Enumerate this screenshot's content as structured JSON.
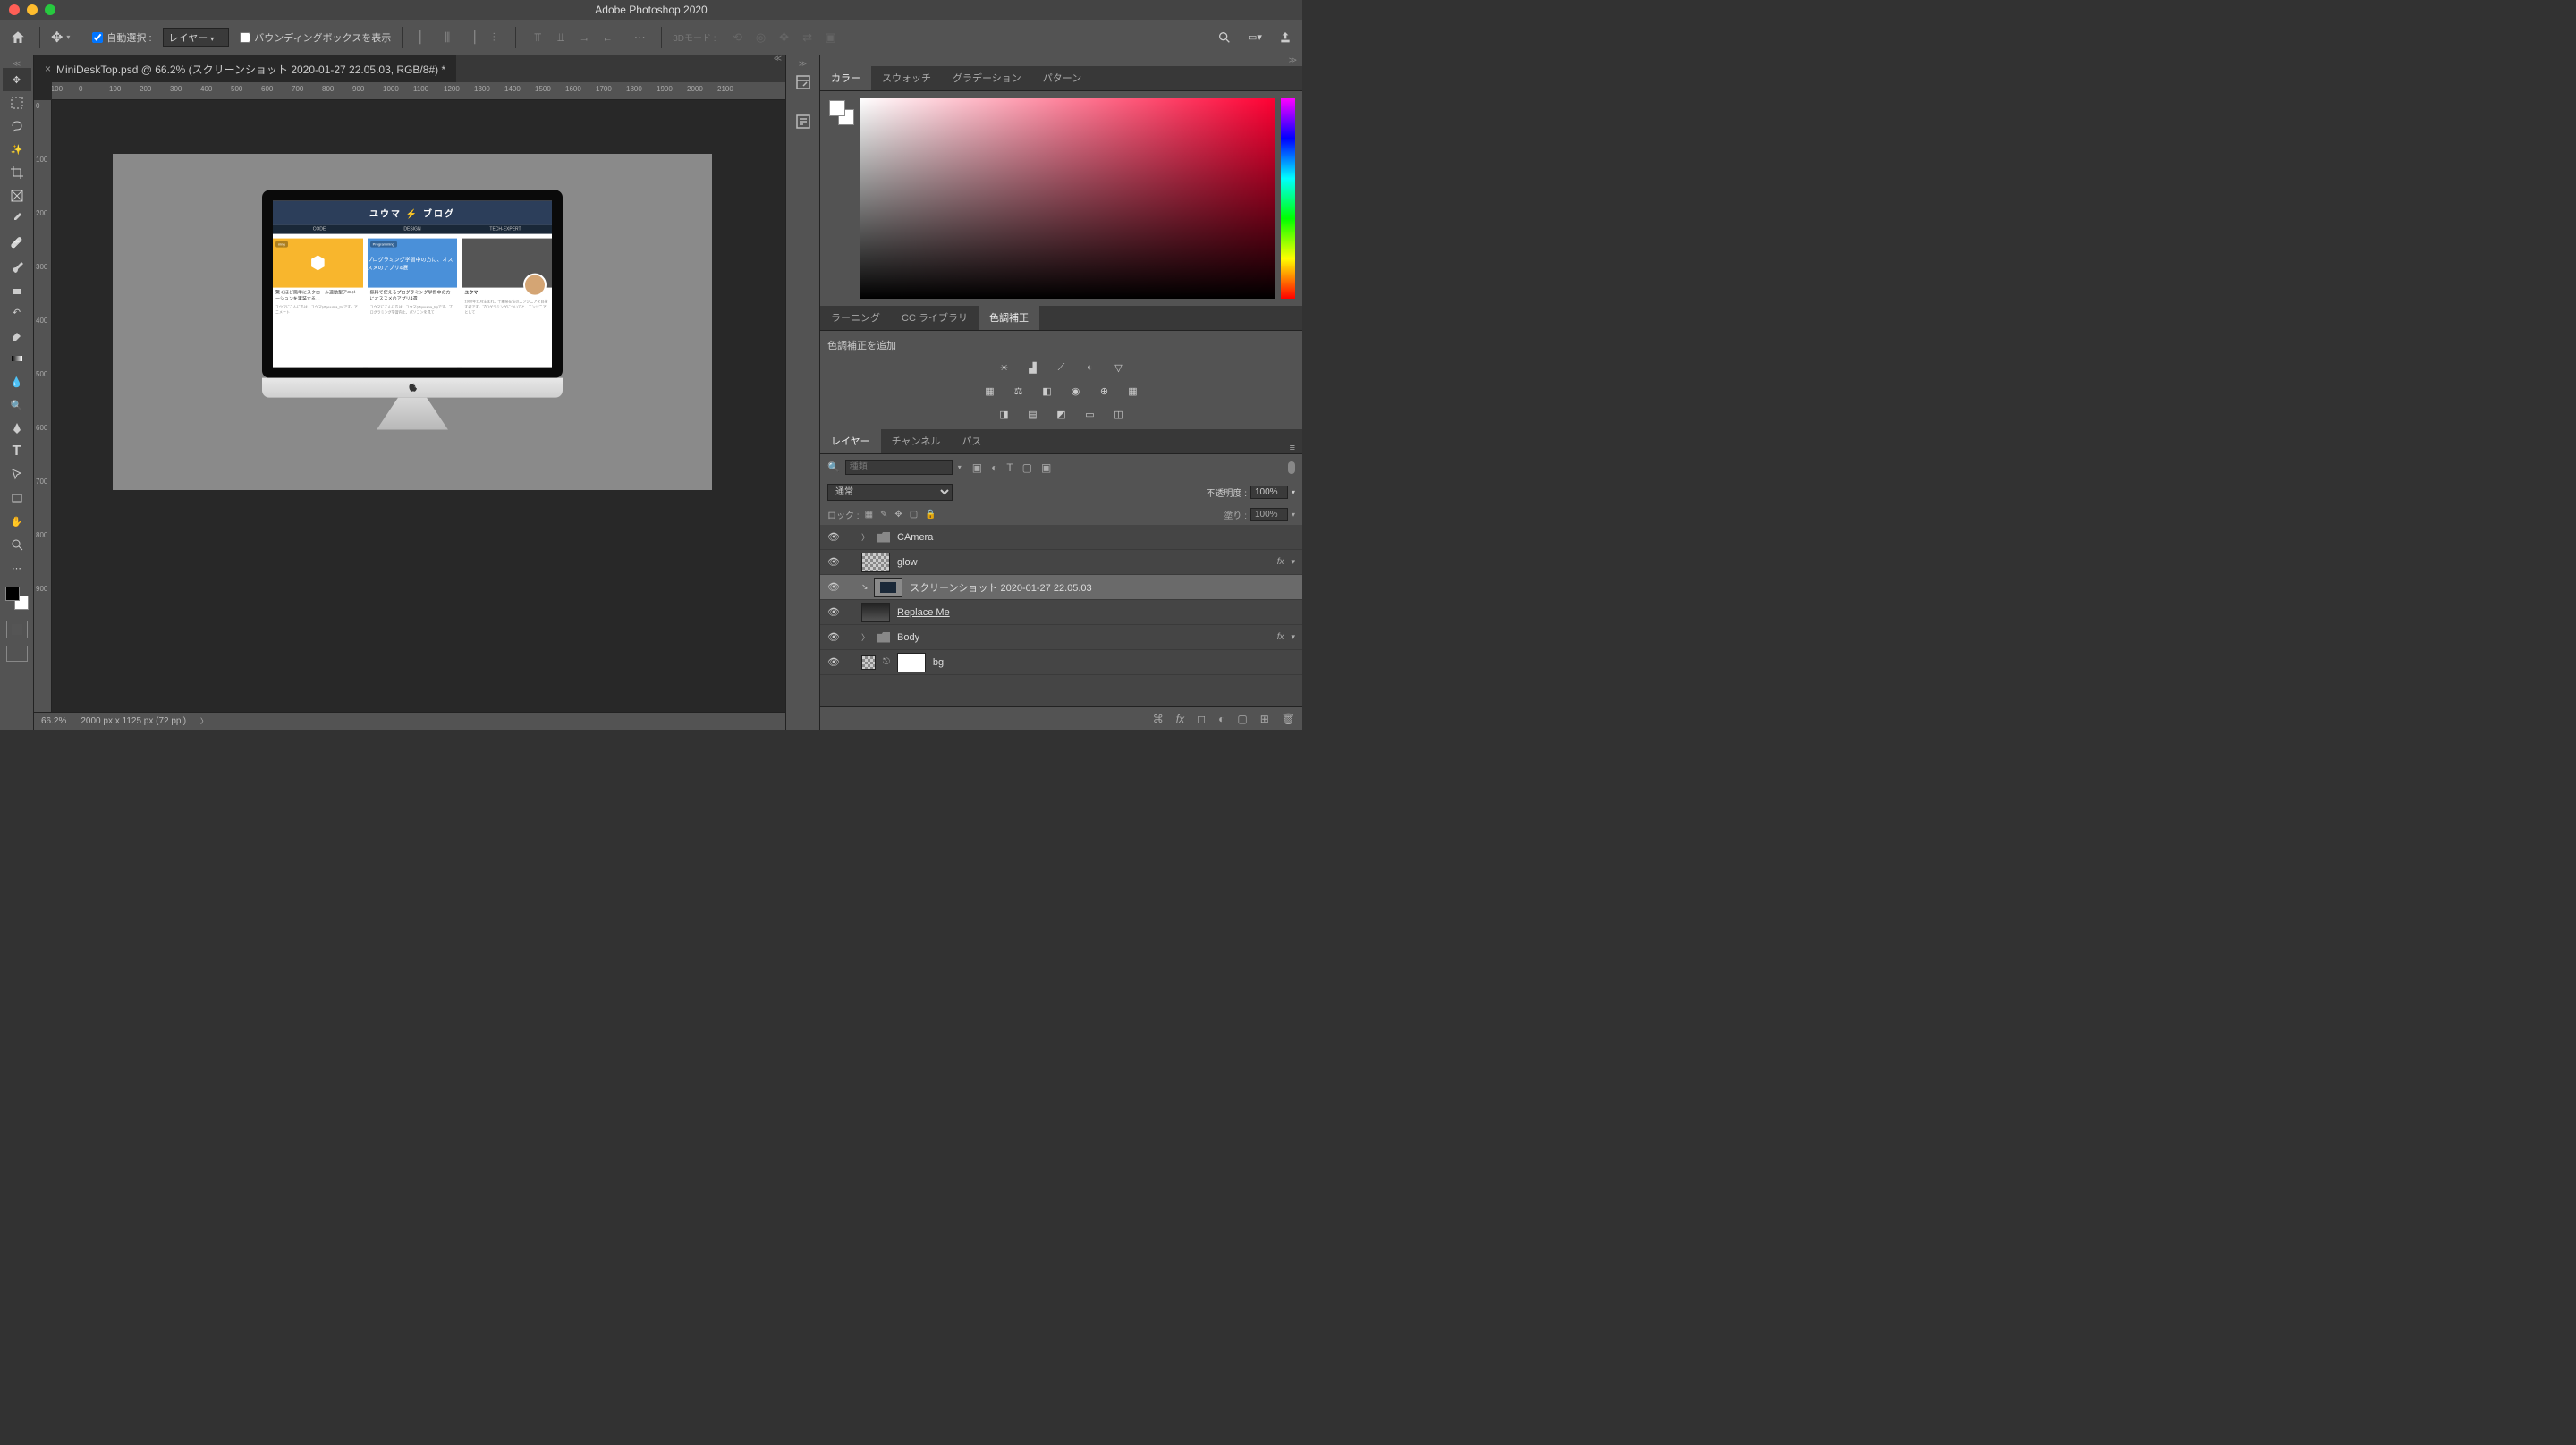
{
  "titlebar": {
    "app_title": "Adobe Photoshop 2020"
  },
  "options": {
    "auto_select_label": "自動選択 :",
    "layer_sel": "レイヤー",
    "bounding_box_label": "バウンディングボックスを表示",
    "mode3d_label": "3Dモード :"
  },
  "document": {
    "tab_title": "MiniDeskTop.psd @ 66.2% (スクリーンショット 2020-01-27 22.05.03, RGB/8#) *",
    "zoom": "66.2%",
    "dimensions": "2000 px x 1125 px (72 ppi)"
  },
  "ruler_marks_h": [
    "-100",
    "0",
    "100",
    "200",
    "300",
    "400",
    "500",
    "600",
    "700",
    "800",
    "900",
    "1000",
    "1100",
    "1200",
    "1300",
    "1400",
    "1500",
    "1600",
    "1700",
    "1800",
    "1900",
    "2000",
    "2100"
  ],
  "ruler_marks_v": [
    "0",
    "100",
    "200",
    "300",
    "400",
    "500",
    "600",
    "700",
    "800",
    "900"
  ],
  "mockup": {
    "blog_title": "ユウマ ⚡ ブログ",
    "nav": [
      "CODE",
      "DESIGN",
      "TECH-EXPERT"
    ],
    "cards": [
      {
        "badge": "ning",
        "title": "簡単にスクロール連動型",
        "txt": "驚くほど簡単にスクロール連動型アニメーションを実装する…",
        "sub": "ユウマにこんにちは、ユウマ(@yuuma_tn)です。アニメート"
      },
      {
        "badge": "Programming",
        "title": "プログラミング学習中の方に、オススメのアプリ4選",
        "txt": "無料で使えるプログラミング学習中の方にオススメのアプリ4選",
        "sub": "ユウマにこんにちは、ユウマ(@yuuma_tn)です。プログラミング学習向上、パソコンを見て"
      },
      {
        "badge": "",
        "title": "ユウマ",
        "txt": "1990年11月生まれ、千葉県在住のエンジニアを目指す者です。プログラミングについてと、エンジニアとして"
      }
    ]
  },
  "panels": {
    "color_tabs": [
      "カラー",
      "スウォッチ",
      "グラデーション",
      "パターン"
    ],
    "learn_tabs": [
      "ラーニング",
      "CC ライブラリ",
      "色調補正"
    ],
    "adjustments_label": "色調補正を追加",
    "layer_tabs": [
      "レイヤー",
      "チャンネル",
      "パス"
    ],
    "search_placeholder": "種類",
    "blend_mode": "通常",
    "opacity_label": "不透明度 :",
    "opacity_value": "100%",
    "lock_label": "ロック :",
    "fill_label": "塗り :",
    "fill_value": "100%",
    "layers": [
      {
        "name": "CAmera",
        "type": "folder"
      },
      {
        "name": "glow",
        "type": "layer",
        "fx": true
      },
      {
        "name": "スクリーンショット 2020-01-27 22.05.03",
        "type": "smart",
        "selected": true
      },
      {
        "name": "Replace Me",
        "type": "smart",
        "underline": true
      },
      {
        "name": "Body",
        "type": "folder",
        "fx": true
      },
      {
        "name": "bg",
        "type": "fill"
      }
    ]
  }
}
